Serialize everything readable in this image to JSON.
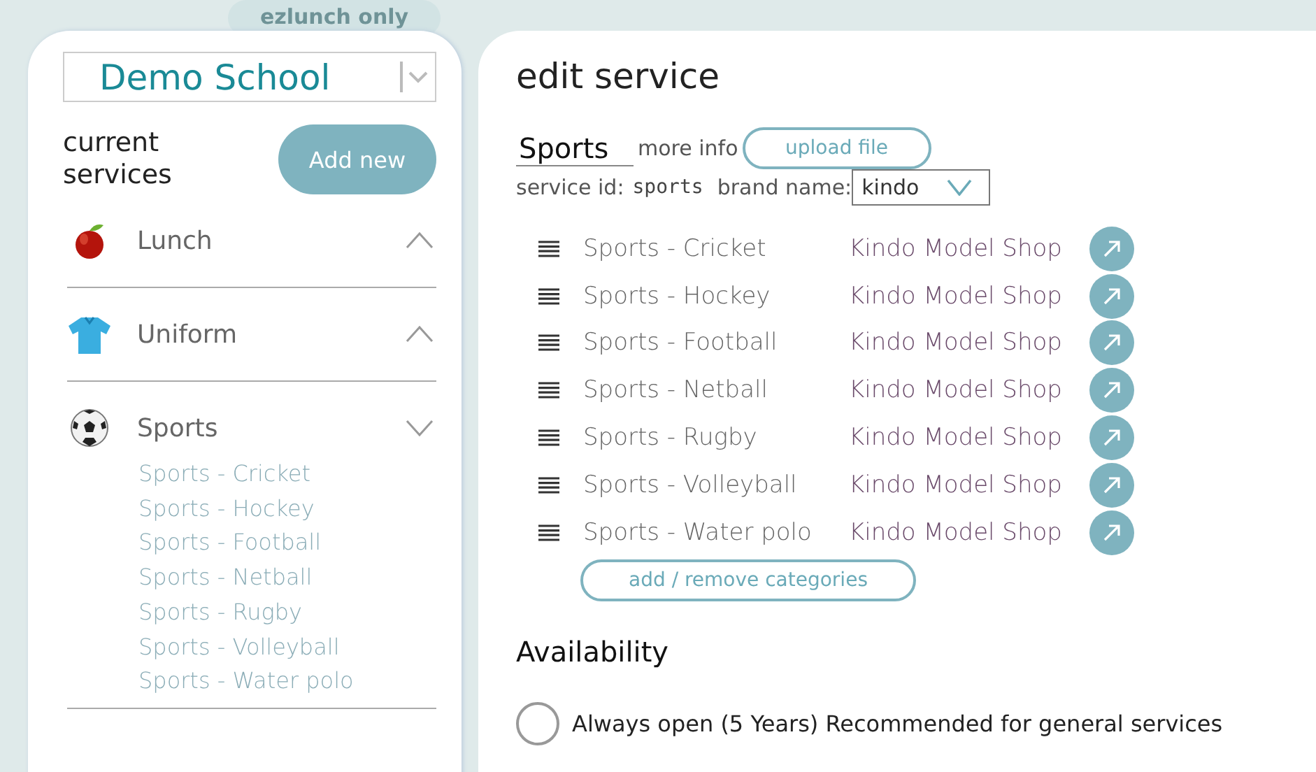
{
  "badge": "ezlunch only",
  "sidebar": {
    "school": "Demo School",
    "heading": "current services",
    "add_button": "Add new",
    "items": [
      {
        "label": "Lunch",
        "kind": "apple",
        "expanded": false
      },
      {
        "label": "Uniform",
        "kind": "shirt",
        "expanded": false
      },
      {
        "label": "Sports",
        "kind": "ball",
        "expanded": true,
        "children": [
          {
            "label": "Sports - Cricket"
          },
          {
            "label": "Sports - Hockey"
          },
          {
            "label": "Sports - Football"
          },
          {
            "label": "Sports - Netball"
          },
          {
            "label": "Sports - Rugby"
          },
          {
            "label": "Sports - Volleyball"
          },
          {
            "label": "Sports - Water polo"
          }
        ]
      }
    ]
  },
  "editor": {
    "title": "edit service",
    "service_name": "Sports",
    "more_info": "more info",
    "upload_button": "upload file",
    "service_id_label": "service id:",
    "service_id": "sports",
    "brand_label": "brand name:",
    "brand": "kindo",
    "categories": [
      {
        "name": "Sports - Cricket",
        "shop": "Kindo Model Shop"
      },
      {
        "name": "Sports - Hockey",
        "shop": "Kindo Model Shop"
      },
      {
        "name": "Sports - Football",
        "shop": "Kindo Model Shop"
      },
      {
        "name": "Sports - Netball",
        "shop": "Kindo Model Shop"
      },
      {
        "name": "Sports - Rugby",
        "shop": "Kindo Model Shop"
      },
      {
        "name": "Sports - Volleyball",
        "shop": "Kindo Model Shop"
      },
      {
        "name": "Sports - Water polo",
        "shop": "Kindo Model Shop"
      }
    ],
    "categories_button": "add / remove categories",
    "availability_heading": "Availability",
    "options": [
      {
        "label": "Always open (5 Years) Recommended for general services",
        "selected": false
      }
    ]
  }
}
